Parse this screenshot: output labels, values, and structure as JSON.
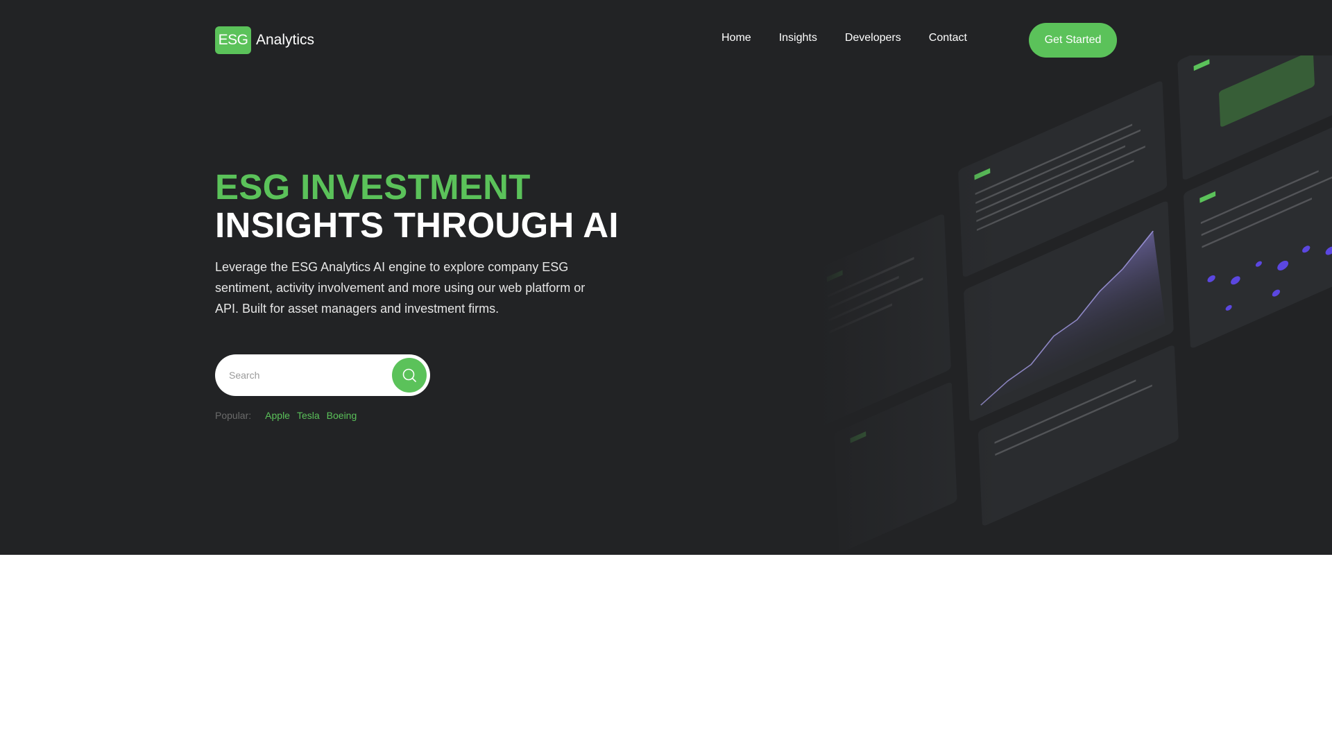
{
  "header": {
    "logo_badge": "ESG",
    "logo_text": "Analytics",
    "nav": [
      "Home",
      "Insights",
      "Developers",
      "Contact"
    ],
    "cta_label": "Get Started"
  },
  "hero": {
    "headline_line1": "ESG INVESTMENT",
    "headline_line2": "INSIGHTS THROUGH AI",
    "lead": "Leverage the ESG Analytics AI engine to explore company ESG sentiment, activity involvement and more using our web platform or API. Built for asset managers and investment firms.",
    "search_placeholder": "Search",
    "popular_label": "Popular:",
    "popular_items": [
      "Apple",
      "Tesla",
      "Boeing"
    ]
  },
  "colors": {
    "hero_bg": "#222325",
    "accent": "#5bc25a",
    "page_bg": "#ffffff"
  },
  "icons": {
    "search": "search-icon",
    "dashboard": "dashboard-illustration"
  }
}
